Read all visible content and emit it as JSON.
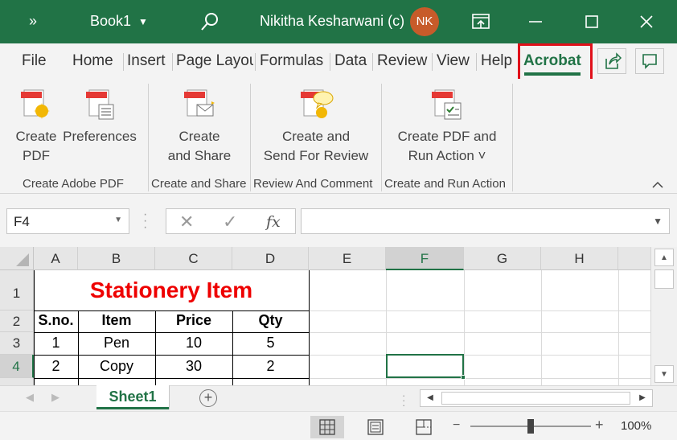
{
  "titlebar": {
    "doc_name": "Book1",
    "user_name": "Nikitha Kesharwani (c)",
    "avatar_initials": "NK",
    "accent_color": "#217346",
    "avatar_color": "#c75b2a"
  },
  "tabs": {
    "items": [
      "File",
      "Home",
      "Insert",
      "Page Layout",
      "Formulas",
      "Data",
      "Review",
      "View",
      "Help",
      "Acrobat"
    ],
    "active": "Acrobat",
    "highlight_color": "#e0101a"
  },
  "ribbon": {
    "groups": [
      {
        "label": "Create Adobe PDF",
        "buttons": [
          {
            "line1": "Create",
            "line2": "PDF"
          },
          {
            "line1": "Preferences",
            "line2": ""
          }
        ]
      },
      {
        "label": "Create and Share",
        "buttons": [
          {
            "line1": "Create",
            "line2": "and Share"
          }
        ]
      },
      {
        "label": "Review And Comment",
        "buttons": [
          {
            "line1": "Create and",
            "line2": "Send For Review"
          }
        ]
      },
      {
        "label": "Create and Run Action",
        "buttons": [
          {
            "line1": "Create PDF and",
            "line2": "Run Action ˅"
          }
        ]
      }
    ]
  },
  "formula_bar": {
    "name_box": "F4",
    "formula": "",
    "fx_label": "fx"
  },
  "sheet": {
    "columns": [
      "A",
      "B",
      "C",
      "D",
      "E",
      "F",
      "G",
      "H"
    ],
    "rows": [
      "1",
      "2",
      "3",
      "4"
    ],
    "selected_column": "F",
    "selected_row": "4",
    "title": "Stationery Item",
    "title_color": "#ee0000",
    "headers": [
      "S.no.",
      "Item",
      "Price",
      "Qty"
    ],
    "data": [
      [
        "1",
        "Pen",
        "10",
        "5"
      ],
      [
        "2",
        "Copy",
        "30",
        "2"
      ]
    ]
  },
  "sheet_tabs": {
    "active": "Sheet1"
  },
  "status": {
    "zoom": "100%",
    "zoom_minus": "−",
    "zoom_plus": "+"
  }
}
